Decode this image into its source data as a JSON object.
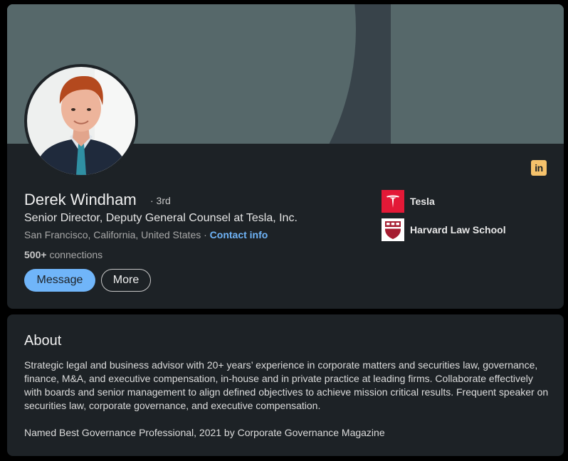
{
  "profile": {
    "name": "Derek Windham",
    "degree": "· 3rd",
    "headline": "Senior Director, Deputy General Counsel at Tesla, Inc.",
    "location": "San Francisco, California, United States ·",
    "contact_label": "Contact info",
    "connections_count": "500+",
    "connections_label": "connections",
    "linkedin_badge": "in"
  },
  "actions": {
    "message_label": "Message",
    "more_label": "More"
  },
  "orgs": [
    {
      "name": "Tesla",
      "icon": "tesla-logo-icon"
    },
    {
      "name": "Harvard Law School",
      "icon": "harvard-shield-icon"
    }
  ],
  "about": {
    "title": "About",
    "paragraph1": "Strategic legal and business advisor with 20+ years’ experience in corporate matters and securities law, governance, finance, M&A, and executive compensation, in-house and in private practice at leading firms. Collaborate effectively with boards and senior management to align defined objectives to achieve mission critical results. Frequent speaker on securities law, corporate governance, and executive compensation.",
    "paragraph2": "Named Best Governance Professional, 2021 by Corporate Governance Magazine"
  },
  "colors": {
    "accent": "#70b5f9",
    "card_bg": "#1d2226",
    "banner": "#56686a",
    "linkedin_badge": "#f5c26b",
    "tesla_red": "#e31937",
    "harvard_crimson": "#a51c30"
  }
}
